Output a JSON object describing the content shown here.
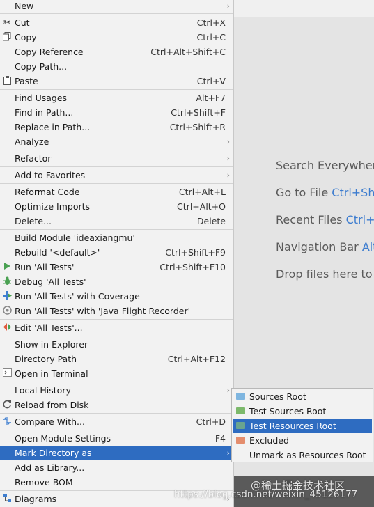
{
  "editor": {
    "hints": [
      {
        "label": "Search Everywhere",
        "shortcut": ""
      },
      {
        "label": "Go to File",
        "shortcut": "Ctrl+Shi"
      },
      {
        "label": "Recent Files",
        "shortcut": "Ctrl+E"
      },
      {
        "label": "Navigation Bar",
        "shortcut": "Alt"
      },
      {
        "label": "Drop files here to o",
        "shortcut": ""
      }
    ]
  },
  "menu": {
    "items": [
      {
        "label": "New",
        "shortcut": "",
        "arrow": "›"
      },
      {
        "label": "Cut",
        "shortcut": "Ctrl+X",
        "icon": "scissors-icon"
      },
      {
        "label": "Copy",
        "shortcut": "Ctrl+C",
        "icon": "copy-icon"
      },
      {
        "label": "Copy Reference",
        "shortcut": "Ctrl+Alt+Shift+C"
      },
      {
        "label": "Copy Path...",
        "shortcut": ""
      },
      {
        "label": "Paste",
        "shortcut": "Ctrl+V",
        "icon": "clipboard-icon"
      },
      {
        "label": "Find Usages",
        "shortcut": "Alt+F7"
      },
      {
        "label": "Find in Path...",
        "shortcut": "Ctrl+Shift+F"
      },
      {
        "label": "Replace in Path...",
        "shortcut": "Ctrl+Shift+R"
      },
      {
        "label": "Analyze",
        "shortcut": "",
        "arrow": "›"
      },
      {
        "label": "Refactor",
        "shortcut": "",
        "arrow": "›"
      },
      {
        "label": "Add to Favorites",
        "shortcut": "",
        "arrow": "›"
      },
      {
        "label": "Reformat Code",
        "shortcut": "Ctrl+Alt+L"
      },
      {
        "label": "Optimize Imports",
        "shortcut": "Ctrl+Alt+O"
      },
      {
        "label": "Delete...",
        "shortcut": "Delete"
      },
      {
        "label": "Build Module 'ideaxiangmu'",
        "shortcut": ""
      },
      {
        "label": "Rebuild '<default>'",
        "shortcut": "Ctrl+Shift+F9"
      },
      {
        "label": "Run 'All Tests'",
        "shortcut": "Ctrl+Shift+F10",
        "icon": "run-icon"
      },
      {
        "label": "Debug 'All Tests'",
        "shortcut": "",
        "icon": "debug-icon"
      },
      {
        "label": "Run 'All Tests' with Coverage",
        "shortcut": "",
        "icon": "coverage-icon"
      },
      {
        "label": "Run 'All Tests' with 'Java Flight Recorder'",
        "shortcut": "",
        "icon": "flight-recorder-icon"
      },
      {
        "label": "Edit 'All Tests'...",
        "shortcut": "",
        "icon": "edit-config-icon"
      },
      {
        "label": "Show in Explorer",
        "shortcut": ""
      },
      {
        "label": "Directory Path",
        "shortcut": "Ctrl+Alt+F12"
      },
      {
        "label": "Open in Terminal",
        "shortcut": "",
        "icon": "terminal-icon"
      },
      {
        "label": "Local History",
        "shortcut": "",
        "arrow": "›"
      },
      {
        "label": "Reload from Disk",
        "shortcut": "",
        "icon": "reload-icon"
      },
      {
        "label": "Compare With...",
        "shortcut": "Ctrl+D",
        "icon": "compare-icon"
      },
      {
        "label": "Open Module Settings",
        "shortcut": "F4"
      },
      {
        "label": "Mark Directory as",
        "shortcut": "",
        "arrow": "›"
      },
      {
        "label": "Add as Library...",
        "shortcut": ""
      },
      {
        "label": "Remove BOM",
        "shortcut": ""
      },
      {
        "label": "Diagrams",
        "shortcut": "",
        "arrow": "›",
        "icon": "diagrams-icon"
      }
    ]
  },
  "submenu": {
    "items": [
      {
        "label": "Sources Root",
        "color": "#7fb6e0"
      },
      {
        "label": "Test Sources Root",
        "color": "#7cb96b"
      },
      {
        "label": "Test Resources Root",
        "color": "#6aa48f"
      },
      {
        "label": "Excluded",
        "color": "#e48d6d"
      },
      {
        "label": "Unmark as Resources Root",
        "color": ""
      }
    ]
  },
  "watermark": {
    "url": "https://blog.csdn.net/weixin_45126177",
    "site": "@稀土掘金技术社区"
  }
}
